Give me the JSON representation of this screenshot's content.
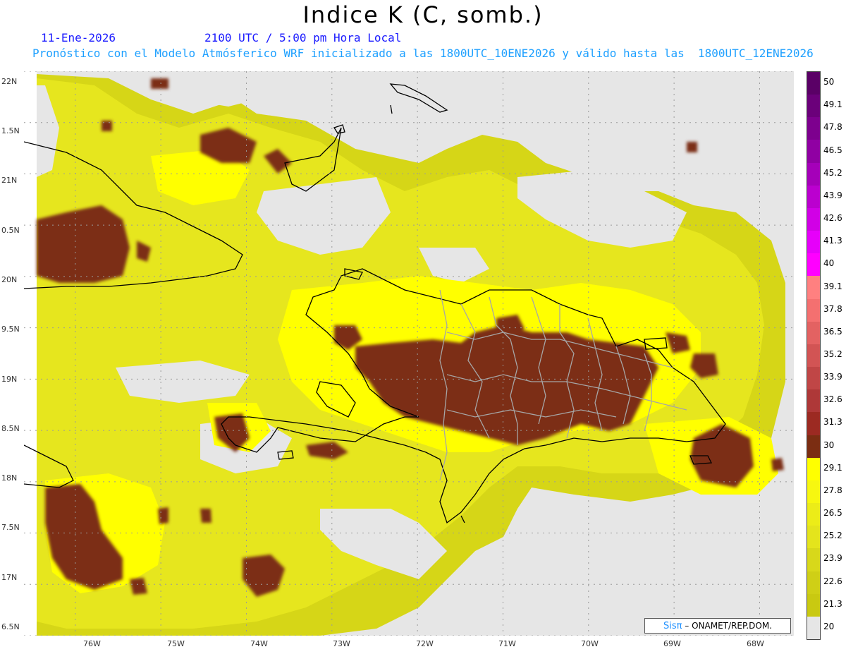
{
  "header": {
    "title": "Indice K (C, somb.)",
    "date": "11-Ene-2026",
    "time": "2100 UTC / 5:00 pm Hora Local",
    "forecast": "Pronóstico con el Modelo Atmósferico WRF inicializado a las 1800UTC_10ENE2026 y válido hasta las  1800UTC_12ENE2026"
  },
  "map": {
    "lat_labels": [
      "22N",
      "1.5N",
      "21N",
      "0.5N",
      "20N",
      "9.5N",
      "19N",
      "8.5N",
      "18N",
      "7.5N",
      "17N",
      "6.5N"
    ],
    "lon_labels": [
      "76W",
      "75W",
      "74W",
      "73W",
      "72W",
      "71W",
      "70W",
      "69W",
      "68W"
    ],
    "lat_range": [
      16.5,
      22.0
    ],
    "lon_range": [
      -76.6,
      -67.6
    ],
    "fill_colors": {
      "no_data": "#e6e6e6",
      "k_20_24": "#c9c911",
      "k_24_27": "#dede1e",
      "k_27_30": "#ffff00",
      "k_30_33": "#7b2d12",
      "coast": "#000000",
      "provinces": "#a6a6a6"
    }
  },
  "colorbar": {
    "labels": [
      "50",
      "49.1",
      "47.8",
      "46.5",
      "45.2",
      "43.9",
      "42.6",
      "41.3",
      "40",
      "39.1",
      "37.8",
      "36.5",
      "35.2",
      "33.9",
      "32.6",
      "31.3",
      "30",
      "29.1",
      "27.8",
      "26.5",
      "25.2",
      "23.9",
      "22.6",
      "21.3",
      "20"
    ],
    "colors": [
      "#5a0066",
      "#6b007a",
      "#7d008e",
      "#9000a3",
      "#a500b9",
      "#bb00cf",
      "#d100e6",
      "#e600fa",
      "#ff00ff",
      "#ff8080",
      "#f47070",
      "#e36262",
      "#d25454",
      "#c04646",
      "#ae3838",
      "#9c2a22",
      "#7b2d12",
      "#ffff00",
      "#f7f710",
      "#ecec18",
      "#e4e41c",
      "#d8d81a",
      "#cfcf16",
      "#c9c911",
      "#e6e6e6"
    ]
  },
  "credit": {
    "brand": "Sisπ",
    "text": "– ONAMET/REP.DOM."
  }
}
